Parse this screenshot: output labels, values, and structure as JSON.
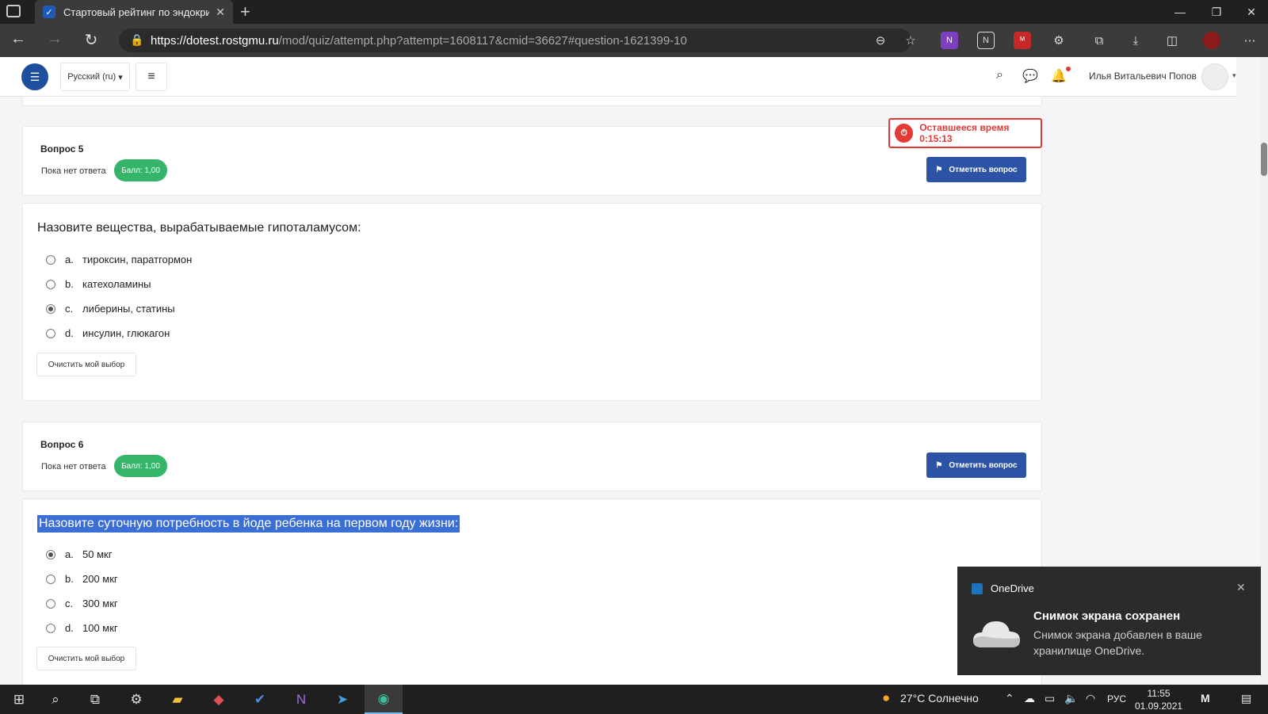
{
  "browser": {
    "tab_title": "Стартовый рейтинг по эндокри",
    "url_host": "https://dotest.rostgmu.ru",
    "url_path": "/mod/quiz/attempt.php?attempt=1608117&cmid=36627#question-1621399-10"
  },
  "header": {
    "language": "Русский (ru)",
    "user_name": "Илья Витальевич Попов"
  },
  "timer": {
    "label": "Оставшееся время 0:15:13"
  },
  "questions": [
    {
      "title": "Вопрос 5",
      "state": "Пока нет ответа",
      "grade": "Балл: 1,00",
      "flag_label": "Отметить вопрос",
      "text": "Назовите вещества, вырабатываемые гипоталамусом:",
      "options": [
        {
          "letter": "a.",
          "text": "тироксин, паратгормон",
          "selected": false
        },
        {
          "letter": "b.",
          "text": "катехоламины",
          "selected": false
        },
        {
          "letter": "c.",
          "text": "либерины, статины",
          "selected": true
        },
        {
          "letter": "d.",
          "text": "инсулин, глюкагон",
          "selected": false
        }
      ],
      "clear_label": "Очистить мой выбор"
    },
    {
      "title": "Вопрос 6",
      "state": "Пока нет ответа",
      "grade": "Балл: 1,00",
      "flag_label": "Отметить вопрос",
      "text": "Назовите суточную потребность в йоде ребенка на первом году жизни:",
      "options": [
        {
          "letter": "a.",
          "text": "50 мкг",
          "selected": true
        },
        {
          "letter": "b.",
          "text": "200 мкг",
          "selected": false
        },
        {
          "letter": "c.",
          "text": "300 мкг",
          "selected": false
        },
        {
          "letter": "d.",
          "text": "100 мкг",
          "selected": false
        }
      ],
      "clear_label": "Очистить мой выбор"
    }
  ],
  "toast": {
    "app": "OneDrive",
    "heading": "Снимок экрана сохранен",
    "body": "Снимок экрана добавлен в ваше хранилище OneDrive."
  },
  "taskbar": {
    "weather": "27°C Солнечно",
    "lang": "РУС",
    "time": "11:55",
    "date": "01.09.2021"
  }
}
